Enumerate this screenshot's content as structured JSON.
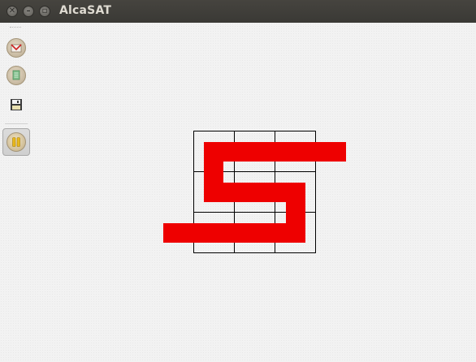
{
  "window": {
    "title": "AlcaSAT"
  },
  "toolbar": {
    "buttons": [
      {
        "icon": "mail-icon",
        "pressed": false
      },
      {
        "icon": "document-icon",
        "pressed": false
      },
      {
        "icon": "save-icon",
        "pressed": false
      },
      {
        "icon": "pause-icon",
        "pressed": true
      }
    ]
  },
  "puzzle": {
    "grid_rows": 3,
    "grid_cols": 3,
    "path_color": "#ee0000",
    "grid_color": "#000000"
  }
}
